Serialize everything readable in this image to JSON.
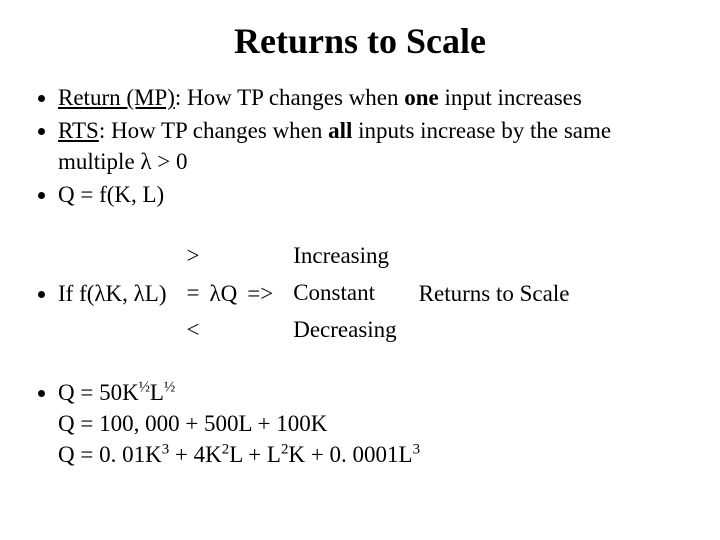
{
  "title": "Returns to Scale",
  "bullets": {
    "b1": {
      "term": "Return (MP)",
      "rest_1": ": How TP changes when ",
      "bold_1": "one",
      "rest_2": " input increases"
    },
    "b2": {
      "term": "RTS",
      "rest_1": ": How TP changes when ",
      "bold_1": "all",
      "rest_2": " inputs increase by the same multiple λ > 0"
    },
    "b3": "Q = f(K, L)"
  },
  "condition": {
    "prefix": "If f(λK, λL)",
    "eq": "=",
    "val": "λQ",
    "arrow": "=>",
    "ops": {
      "gt": ">",
      "eq": "=",
      "lt": "<"
    },
    "labels": {
      "inc": "Increasing",
      "con": "Constant",
      "dec": "Decreasing"
    },
    "suffix": "Returns to Scale"
  },
  "examples": {
    "e1_a": "Q = 50K",
    "e1_b": "½",
    "e1_c": "L",
    "e1_d": "½",
    "e2": "Q = 100, 000 + 500L + 100K",
    "e3_a": "Q = 0. 01K",
    "e3_b": "3",
    "e3_c": " + 4K",
    "e3_d": "2",
    "e3_e": "L + L",
    "e3_f": "2",
    "e3_g": "K + 0. 0001L",
    "e3_h": "3"
  }
}
